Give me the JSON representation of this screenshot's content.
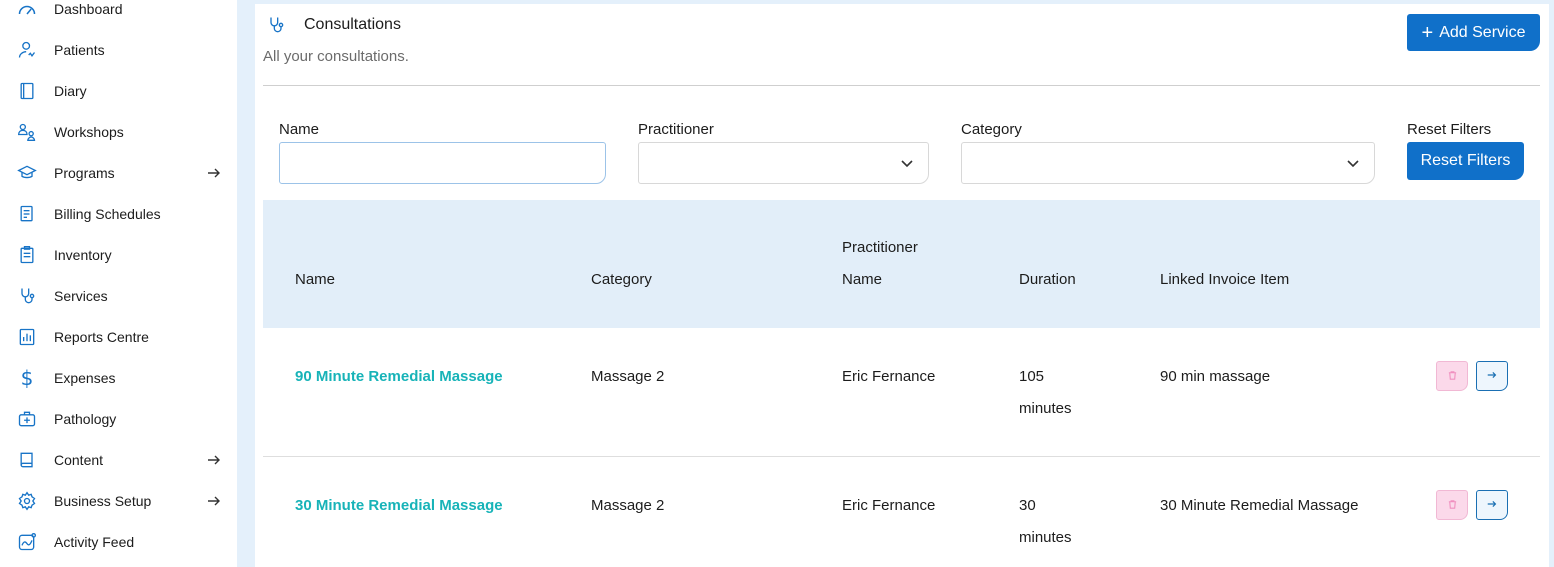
{
  "sidebar": {
    "items": [
      {
        "label": "Dashboard",
        "icon": "dashboard-icon"
      },
      {
        "label": "Patients",
        "icon": "patients-icon"
      },
      {
        "label": "Diary",
        "icon": "diary-icon"
      },
      {
        "label": "Workshops",
        "icon": "workshops-icon"
      },
      {
        "label": "Programs",
        "icon": "programs-icon",
        "has_submenu": true
      },
      {
        "label": "Billing Schedules",
        "icon": "billing-icon"
      },
      {
        "label": "Inventory",
        "icon": "inventory-icon"
      },
      {
        "label": "Services",
        "icon": "stethoscope-icon"
      },
      {
        "label": "Reports Centre",
        "icon": "reports-icon"
      },
      {
        "label": "Expenses",
        "icon": "dollar-icon"
      },
      {
        "label": "Pathology",
        "icon": "medical-kit-icon"
      },
      {
        "label": "Content",
        "icon": "book-icon",
        "has_submenu": true
      },
      {
        "label": "Business Setup",
        "icon": "gear-icon",
        "has_submenu": true
      },
      {
        "label": "Activity Feed",
        "icon": "activity-icon"
      }
    ]
  },
  "header": {
    "title": "Consultations",
    "subtitle": "All your consultations.",
    "add_button": "Add Service",
    "add_icon": "+"
  },
  "filters": {
    "name_label": "Name",
    "name_value": "",
    "practitioner_label": "Practitioner",
    "practitioner_value": "",
    "category_label": "Category",
    "category_value": "",
    "reset_label": "Reset Filters",
    "reset_button": "Reset Filters"
  },
  "table": {
    "headers": {
      "name": "Name",
      "category": "Category",
      "practitioner_line1": "Practitioner",
      "practitioner_line2": "Name",
      "duration": "Duration",
      "linked": "Linked Invoice Item"
    },
    "rows": [
      {
        "name": "90 Minute Remedial Massage",
        "category": "Massage 2",
        "practitioner": "Eric Fernance",
        "duration_num": "105",
        "duration_unit": "minutes",
        "linked": "90 min massage"
      },
      {
        "name": "30 Minute Remedial Massage",
        "category": "Massage 2",
        "practitioner": "Eric Fernance",
        "duration_num": "30",
        "duration_unit": "minutes",
        "linked": "30 Minute Remedial Massage"
      }
    ]
  },
  "colors": {
    "accent": "#1070c9",
    "link": "#17b3b8",
    "table_header_bg": "#e2eef9",
    "page_bg": "#e4f0fb"
  }
}
